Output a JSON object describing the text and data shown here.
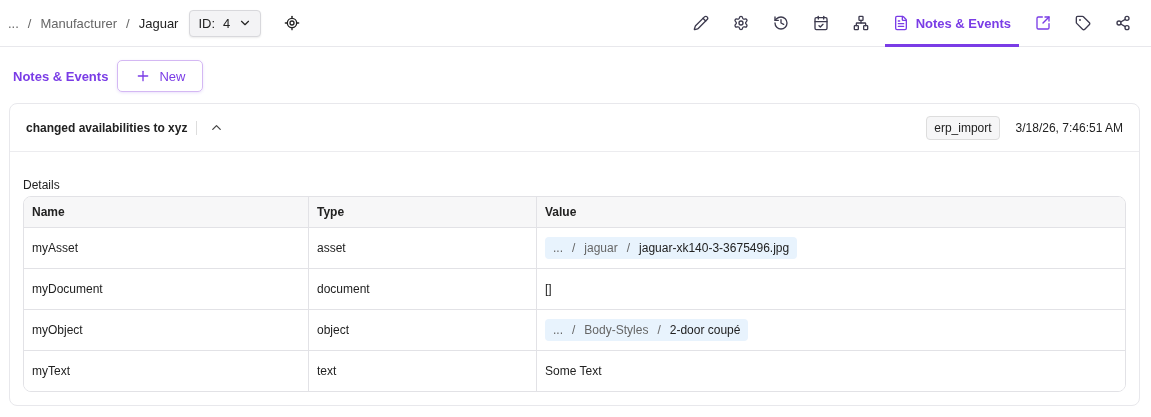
{
  "breadcrumb": {
    "separator": "/",
    "items": [
      "...",
      "Manufacturer",
      "Jaguar"
    ],
    "id_label": "ID:",
    "id_value": "4"
  },
  "toolbar": {
    "tabs": [
      {
        "kind": "edit",
        "selected": false
      },
      {
        "kind": "settings",
        "selected": false
      },
      {
        "kind": "history",
        "selected": false
      },
      {
        "kind": "schedule",
        "selected": false
      },
      {
        "kind": "tree",
        "selected": false
      },
      {
        "kind": "notes",
        "label": "Notes & Events",
        "selected": true
      },
      {
        "kind": "open",
        "selected": false
      },
      {
        "kind": "tag",
        "selected": false
      },
      {
        "kind": "share",
        "selected": false
      }
    ]
  },
  "section": {
    "title": "Notes & Events",
    "new_button": "New"
  },
  "note": {
    "title": "changed availabilities to xyz",
    "expanded": true,
    "user": "erp_import",
    "date": "3/18/26, 7:46:51 AM",
    "details_label": "Details",
    "columns": [
      "Name",
      "Type",
      "Value"
    ],
    "rows": [
      {
        "name": "myAsset",
        "type": "asset",
        "value": {
          "kind": "path",
          "separator": "/",
          "segments": [
            "...",
            "jaguar",
            "jaguar-xk140-3-3675496.jpg"
          ]
        }
      },
      {
        "name": "myDocument",
        "type": "document",
        "value": {
          "kind": "text",
          "text": "[]"
        }
      },
      {
        "name": "myObject",
        "type": "object",
        "value": {
          "kind": "path",
          "separator": "/",
          "segments": [
            "...",
            "Body-Styles",
            "2-door coupé"
          ]
        }
      },
      {
        "name": "myText",
        "type": "text",
        "value": {
          "kind": "text",
          "text": "Some Text"
        }
      }
    ]
  }
}
